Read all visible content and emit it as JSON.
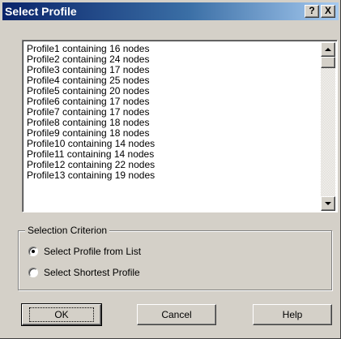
{
  "window": {
    "title": "Select Profile",
    "help_glyph": "?",
    "close_glyph": "X"
  },
  "profile_list": {
    "items": [
      "Profile1 containing 16 nodes",
      "Profile2 containing 24 nodes",
      "Profile3 containing 17 nodes",
      "Profile4 containing 25 nodes",
      "Profile5 containing 20 nodes",
      "Profile6 containing 17 nodes",
      "Profile7 containing 17 nodes",
      "Profile8 containing 18 nodes",
      "Profile9 containing 18 nodes",
      "Profile10 containing 14 nodes",
      "Profile11 containing 14 nodes",
      "Profile12 containing 22 nodes",
      "Profile13 containing 19 nodes"
    ]
  },
  "selection_criterion": {
    "legend": "Selection Criterion",
    "options": [
      {
        "label": "Select Profile from List",
        "selected": true
      },
      {
        "label": "Select Shortest Profile",
        "selected": false
      }
    ]
  },
  "buttons": {
    "ok": "OK",
    "cancel": "Cancel",
    "help": "Help"
  },
  "colors": {
    "dialog_face": "#d4d0c8",
    "title_active": "#0a246a",
    "title_gradient_end": "#a6caf0"
  }
}
